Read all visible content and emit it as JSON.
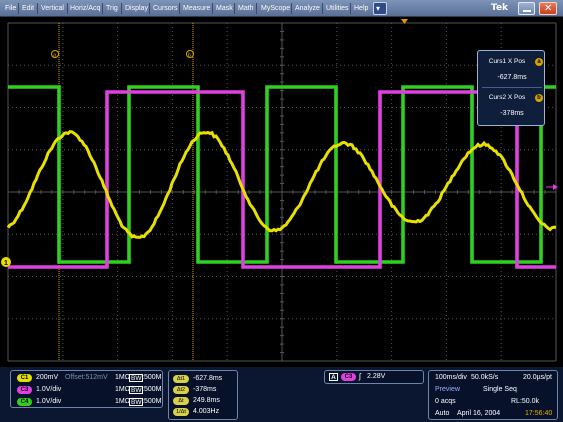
{
  "menu": {
    "items": [
      "File",
      "Edit",
      "Vertical",
      "Horiz/Acq",
      "Trig",
      "Display",
      "Cursors",
      "Measure",
      "Mask",
      "Math",
      "MyScope",
      "Analyze",
      "Utilities",
      "Help"
    ],
    "dropdown_glyph": "▾",
    "brand": "Tek",
    "close_glyph": "✕"
  },
  "screen": {
    "cursor_a_label": "a",
    "cursor_b_label": "b",
    "ch1_marker": "1"
  },
  "cursor_readout": {
    "curs1_label": "Curs1 X Pos",
    "curs1_badge": "a",
    "curs1_value": "-627.8ms",
    "curs2_label": "Curs2 X Pos",
    "curs2_badge": "b",
    "curs2_value": "-378ms"
  },
  "channels": [
    {
      "badge": "C1",
      "scale": "200mV",
      "offset": "Offset:512mV",
      "impedance": "1MΩ",
      "bw_icon": "BW",
      "bandwidth": ":500M",
      "color": "#e8e000"
    },
    {
      "badge": "C3",
      "scale": "1.0V/div",
      "offset": "",
      "impedance": "1MΩ",
      "bw_icon": "BW",
      "bandwidth": ":500M",
      "color": "#e040e0"
    },
    {
      "badge": "C4",
      "scale": "1.0V/div",
      "offset": "",
      "impedance": "1MΩ",
      "bw_icon": "BW",
      "bandwidth": ":500M",
      "color": "#30d020"
    }
  ],
  "measurements": [
    {
      "badge": "Δt1",
      "value": "-627.8ms"
    },
    {
      "badge": "Δt2",
      "value": "-378ms"
    },
    {
      "badge": "Δt",
      "value": "249.8ms"
    },
    {
      "badge": "1/Δt",
      "value": "4.003Hz"
    }
  ],
  "trigger": {
    "mode_badge": "A",
    "source_badge": "C3",
    "slope_glyph": "ʃ",
    "level": "2.28V"
  },
  "acquisition": {
    "timebase": "100ms/div",
    "sample_rate": "50.0kS/s",
    "resolution": "20.0µs/pt",
    "state": "Preview",
    "mode": "Single Seq",
    "acqs": "0 acqs",
    "record_length": "RL:50.0k",
    "trigger_mode": "Auto",
    "date": "April 16, 2004",
    "time": "17:56:40"
  },
  "colors": {
    "ch1": "#e8e000",
    "ch3": "#e040e0",
    "ch4": "#30d020",
    "cursor": "#d8a400",
    "grid": "#555555"
  }
}
